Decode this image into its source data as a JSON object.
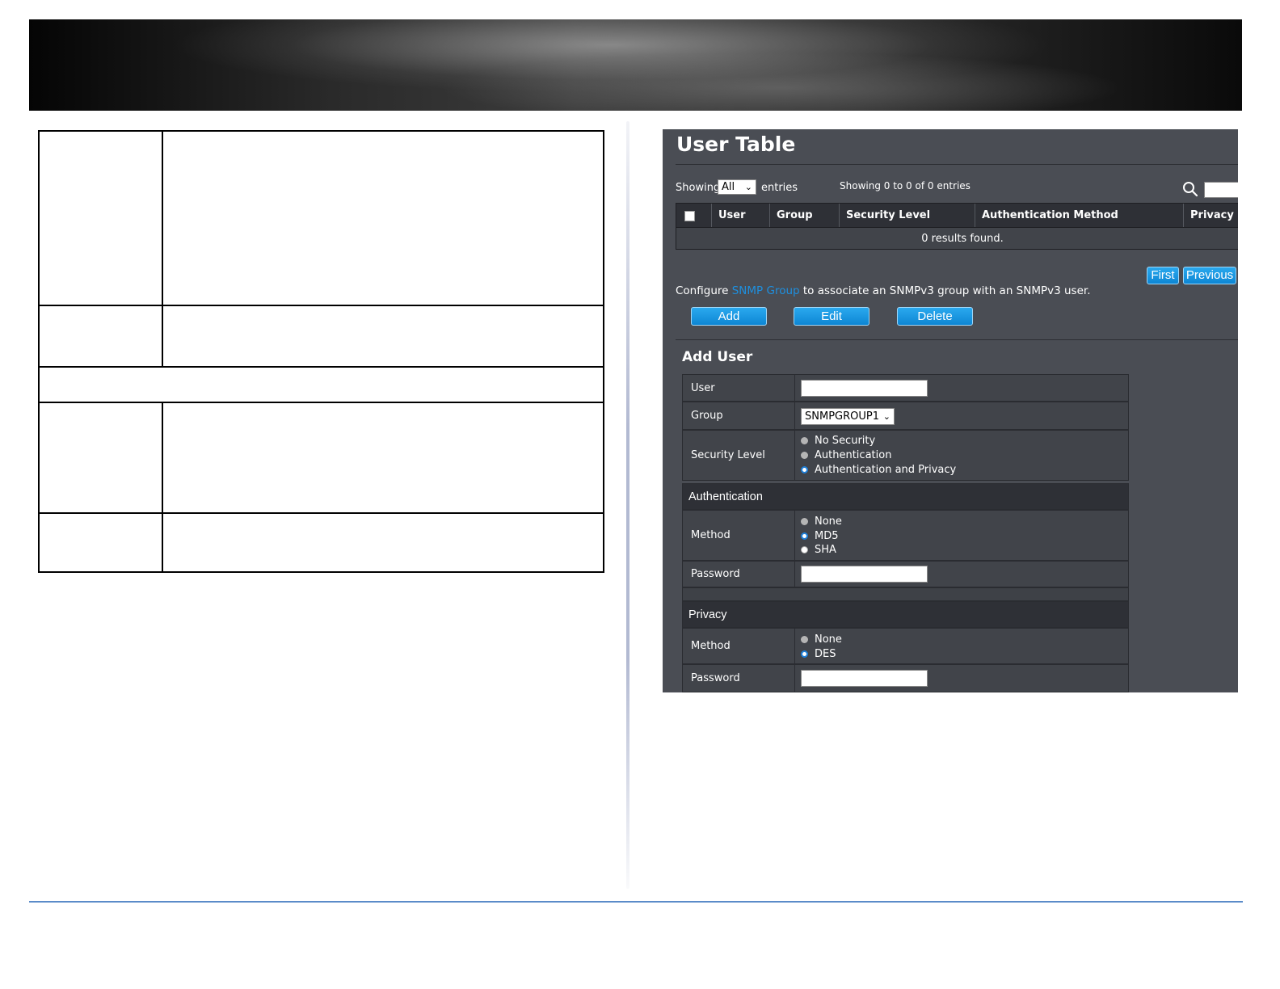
{
  "panel": {
    "title": "User Table",
    "showing_label": "Showing",
    "showing_value": "All",
    "entries_label": "entries",
    "showing_summary": "Showing 0 to 0 of 0 entries",
    "columns": [
      "User",
      "Group",
      "Security Level",
      "Authentication Method",
      "Privacy M"
    ],
    "empty_message": "0 results found.",
    "pager": {
      "first": "First",
      "previous": "Previous"
    },
    "configure_prefix": "Configure",
    "configure_link": "SNMP Group",
    "configure_suffix": "to associate an SNMPv3 group with an SNMPv3 user.",
    "buttons": {
      "add": "Add",
      "edit": "Edit",
      "delete": "Delete"
    }
  },
  "add_user": {
    "title": "Add User",
    "user_label": "User",
    "user_value": "",
    "group_label": "Group",
    "group_value": "SNMPGROUP1",
    "security_level_label": "Security Level",
    "security_levels": [
      "No Security",
      "Authentication",
      "Authentication and Privacy"
    ],
    "security_level_selected": "Authentication and Privacy",
    "authentication_section": "Authentication",
    "auth_method_label": "Method",
    "auth_methods": [
      "None",
      "MD5",
      "SHA"
    ],
    "auth_method_selected": "MD5",
    "auth_password_label": "Password",
    "privacy_section": "Privacy",
    "privacy_method_label": "Method",
    "privacy_methods": [
      "None",
      "DES"
    ],
    "privacy_method_selected": "DES",
    "privacy_password_label": "Password"
  },
  "colors": {
    "panel_bg": "#4a4d54",
    "header_bg": "#2e3036",
    "button_blue": "#1a96e2",
    "link_blue": "#1e8fde",
    "footer_line": "#5b8bc9"
  },
  "icons": [
    "search-icon",
    "chevron-down-icon",
    "checkbox-icon",
    "radio-icon"
  ]
}
